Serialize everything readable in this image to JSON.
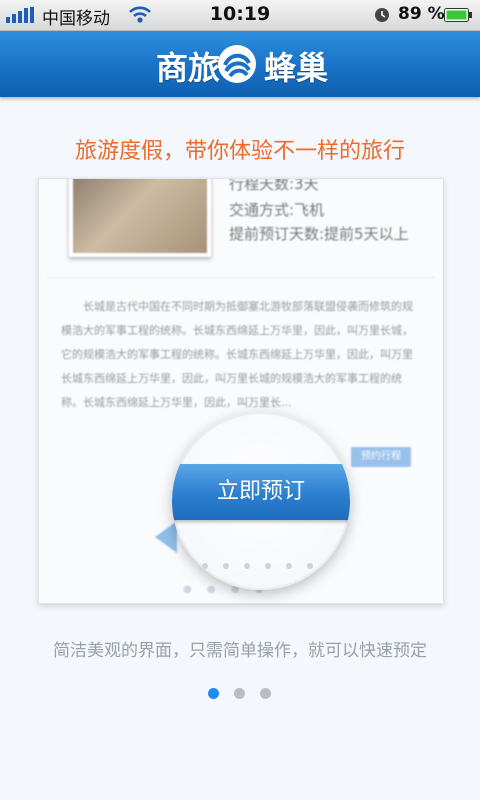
{
  "status_bar": {
    "carrier": "中国移动",
    "time": "10:19",
    "battery": "89 %"
  },
  "header": {
    "logo_left": "商旅",
    "logo_right": "蜂巢",
    "brand_color": "#1872c6"
  },
  "headline": "旅游度假，带你体验不一样的旅行",
  "card": {
    "info": [
      "行程天数:3天",
      "交通方式:飞机",
      "提前预订天数:提前5天以上"
    ],
    "paragraph": "长城是古代中国在不同时期为抵御塞北游牧部落联盟侵袭而修筑的规模浩大的军事工程的统称。长城东西绵延上万华里，因此，叫万里长城，它的规模浩大的军事工程的统称。长城东西绵延上万华里，因此，叫万里长城东西绵延上万华里，因此，叫万里长城的规模浩大的军事工程的统称。长城东西绵延上万华里，因此，叫万里长...",
    "mini_button": "预约行程"
  },
  "magnifier": {
    "button": "立即预订"
  },
  "caption": "简洁美观的界面，只需简单操作，就可以快速预定",
  "pager": {
    "total": 3,
    "active": 1,
    "active_color": "#1f8bea"
  }
}
